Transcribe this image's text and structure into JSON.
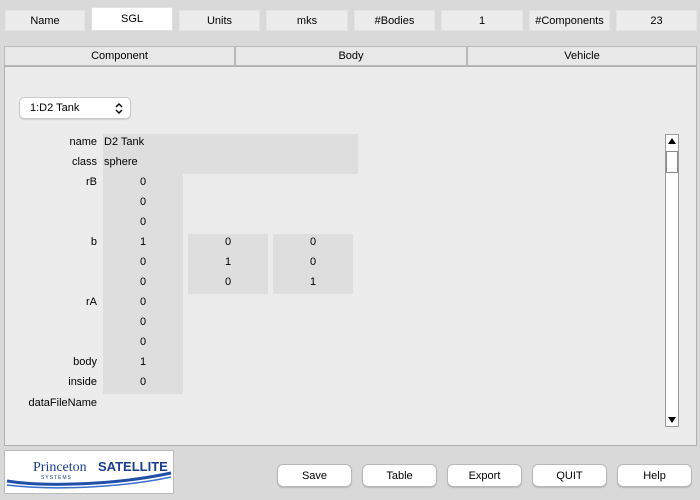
{
  "header": {
    "name_label": "Name",
    "name_value": "SGL",
    "units_label": "Units",
    "units_value": "mks",
    "bodies_label": "#Bodies",
    "bodies_value": "1",
    "components_label": "#Components",
    "components_value": "23"
  },
  "tabs": [
    "Component",
    "Body",
    "Vehicle"
  ],
  "component_select": {
    "value": "1:D2 Tank"
  },
  "fields": {
    "name_label": "name",
    "name_value": "D2 Tank",
    "class_label": "class",
    "class_value": "sphere",
    "rB_label": "rB",
    "rB": [
      "0",
      "0",
      "0"
    ],
    "b_label": "b",
    "b": [
      [
        "1",
        "0",
        "0"
      ],
      [
        "0",
        "1",
        "0"
      ],
      [
        "0",
        "0",
        "1"
      ]
    ],
    "rA_label": "rA",
    "rA": [
      "0",
      "0",
      "0"
    ],
    "body_label": "body",
    "body_value": "1",
    "inside_label": "inside",
    "inside_value": "0",
    "dataFileName_label": "dataFileName"
  },
  "logo": {
    "text_left": "Princeton",
    "text_right": "SATELLITE",
    "text_bottom": "SYSTEMS"
  },
  "buttons": {
    "save": "Save",
    "table": "Table",
    "export": "Export",
    "quit": "QUIT",
    "help": "Help"
  }
}
